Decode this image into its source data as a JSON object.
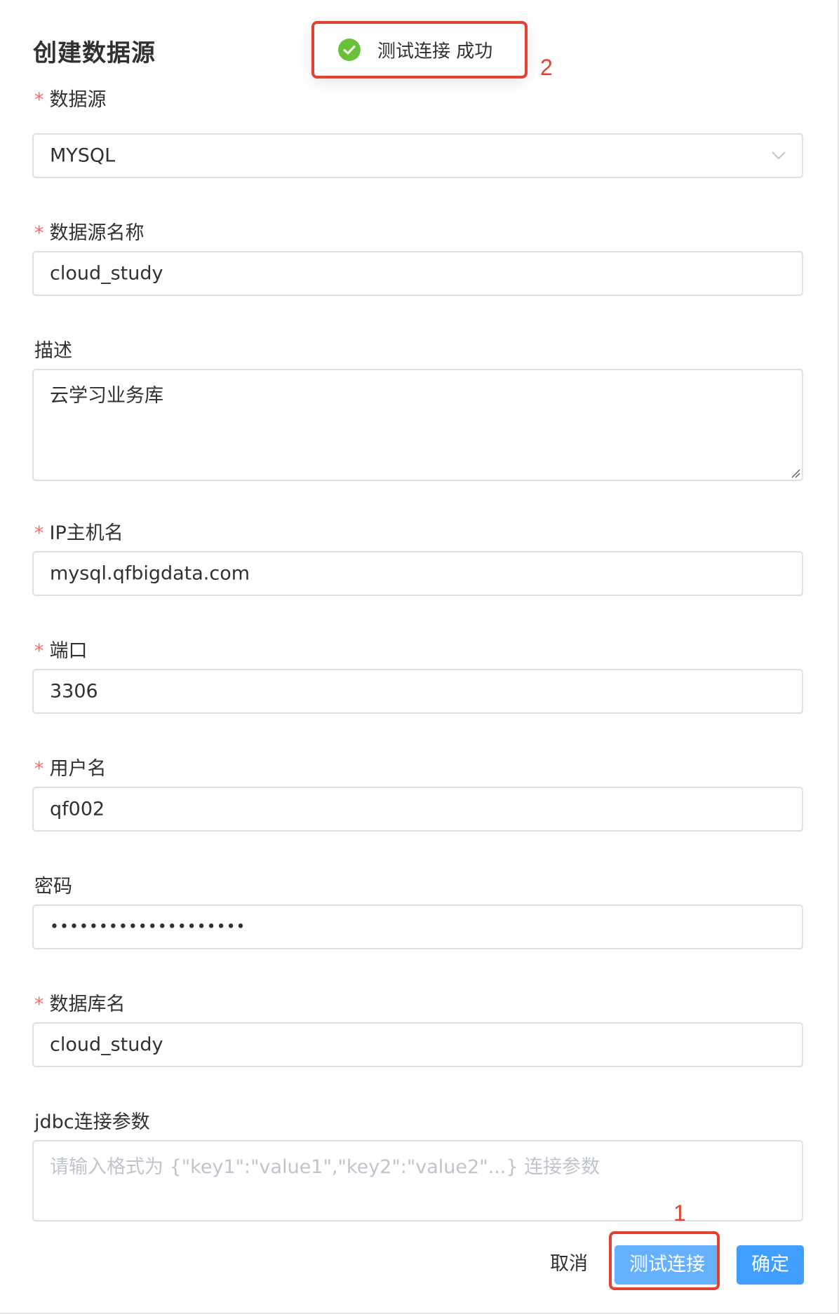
{
  "dialog": {
    "title": "创建数据源"
  },
  "toast": {
    "message": "测试连接 成功",
    "icon": "success-check-icon",
    "color": "#67c23a"
  },
  "annotations": {
    "toast_number": "2",
    "button_number": "1",
    "color": "#e2412f"
  },
  "fields": {
    "datasource": {
      "required": "*",
      "label": "数据源",
      "value": "MYSQL"
    },
    "name": {
      "required": "*",
      "label": "数据源名称",
      "value": "cloud_study"
    },
    "description": {
      "label": "描述",
      "value": "云学习业务库"
    },
    "host": {
      "required": "*",
      "label": "IP主机名",
      "value": "mysql.qfbigdata.com"
    },
    "port": {
      "required": "*",
      "label": "端口",
      "value": "3306"
    },
    "username": {
      "required": "*",
      "label": "用户名",
      "value": "qf002"
    },
    "password": {
      "label": "密码",
      "value": "••••••••••••••••••••"
    },
    "database": {
      "required": "*",
      "label": "数据库名",
      "value": "cloud_study"
    },
    "jdbc": {
      "label": "jdbc连接参数",
      "placeholder": "请输入格式为 {\"key1\":\"value1\",\"key2\":\"value2\"...} 连接参数"
    }
  },
  "footer": {
    "cancel_label": "取消",
    "test_label": "测试连接",
    "confirm_label": "确定"
  },
  "colors": {
    "primary": "#409eff",
    "primary_light": "#66b1ff",
    "required": "#f56c6c",
    "border": "#dcdfe6",
    "placeholder": "#c0c4cc"
  }
}
